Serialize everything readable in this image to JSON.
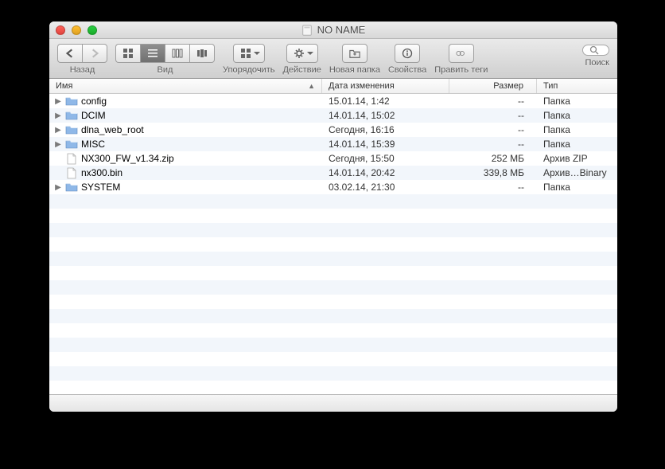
{
  "window": {
    "title": "NO NAME"
  },
  "toolbar": {
    "back_label": "Назад",
    "view_label": "Вид",
    "arrange_label": "Упорядочить",
    "action_label": "Действие",
    "newfolder_label": "Новая папка",
    "properties_label": "Свойства",
    "edittags_label": "Править теги",
    "search_label": "Поиск"
  },
  "columns": {
    "name": "Имя",
    "date": "Дата изменения",
    "size": "Размер",
    "type": "Тип"
  },
  "rows": [
    {
      "expandable": true,
      "icon": "folder",
      "name": "config",
      "date": "15.01.14, 1:42",
      "size": "--",
      "type": "Папка"
    },
    {
      "expandable": true,
      "icon": "folder",
      "name": "DCIM",
      "date": "14.01.14, 15:02",
      "size": "--",
      "type": "Папка"
    },
    {
      "expandable": true,
      "icon": "folder",
      "name": "dlna_web_root",
      "date": "Сегодня, 16:16",
      "size": "--",
      "type": "Папка"
    },
    {
      "expandable": true,
      "icon": "folder",
      "name": "MISC",
      "date": "14.01.14, 15:39",
      "size": "--",
      "type": "Папка"
    },
    {
      "expandable": false,
      "icon": "file",
      "name": "NX300_FW_v1.34.zip",
      "date": "Сегодня, 15:50",
      "size": "252 МБ",
      "type": "Архив ZIP"
    },
    {
      "expandable": false,
      "icon": "file",
      "name": "nx300.bin",
      "date": "14.01.14, 20:42",
      "size": "339,8 МБ",
      "type": "Архив…Binary"
    },
    {
      "expandable": true,
      "icon": "folder",
      "name": "SYSTEM",
      "date": "03.02.14, 21:30",
      "size": "--",
      "type": "Папка"
    }
  ]
}
